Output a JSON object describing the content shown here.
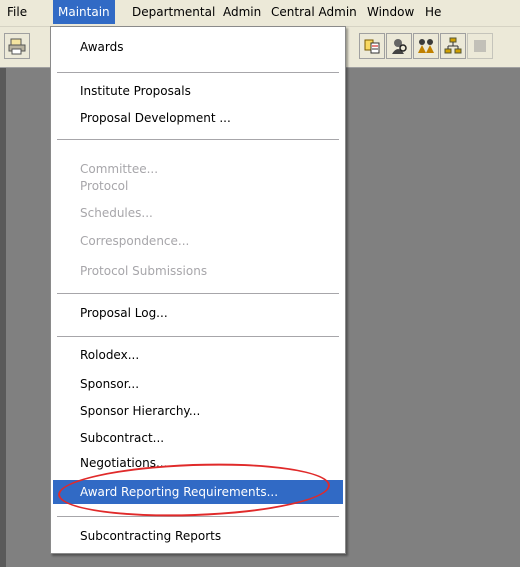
{
  "menubar": {
    "items": [
      {
        "label": "File"
      },
      {
        "label": "Maintain"
      },
      {
        "label": "Departmental"
      },
      {
        "label": "Admin"
      },
      {
        "label": "Central Admin"
      },
      {
        "label": "Window"
      },
      {
        "label": "He"
      }
    ],
    "active_index": 1
  },
  "toolbar": {
    "left_icon": "printer-icon",
    "right_icons": [
      "proposal-icon",
      "person-search-icon",
      "people-icon",
      "hierarchy-icon",
      "disabled-icon"
    ]
  },
  "maintain_menu": {
    "groups": [
      {
        "items": [
          {
            "label": "Awards",
            "enabled": true
          }
        ]
      },
      {
        "items": [
          {
            "label": "Institute Proposals",
            "enabled": true
          },
          {
            "label": "Proposal Development ...",
            "enabled": true
          }
        ]
      },
      {
        "items": [
          {
            "label": "Committee...",
            "enabled": false
          },
          {
            "label": "Protocol",
            "enabled": false
          },
          {
            "label": "Schedules...",
            "enabled": false
          },
          {
            "label": "Correspondence...",
            "enabled": false
          },
          {
            "label": "Protocol Submissions",
            "enabled": false
          }
        ]
      },
      {
        "items": [
          {
            "label": "Proposal Log...",
            "enabled": true
          }
        ]
      },
      {
        "items": [
          {
            "label": "Rolodex...",
            "enabled": true
          },
          {
            "label": "Sponsor...",
            "enabled": true
          },
          {
            "label": "Sponsor Hierarchy...",
            "enabled": true
          },
          {
            "label": "Subcontract...",
            "enabled": true
          },
          {
            "label": "Negotiations...",
            "enabled": true
          },
          {
            "label": "Award Reporting Requirements...",
            "enabled": true,
            "selected": true
          }
        ]
      },
      {
        "items": [
          {
            "label": "Subcontracting Reports",
            "enabled": true
          }
        ]
      }
    ]
  },
  "colors": {
    "selection": "#316ac5",
    "menu_bar": "#ece9d8",
    "desktop": "#808080",
    "annotation_oval": "#e02a2a"
  }
}
